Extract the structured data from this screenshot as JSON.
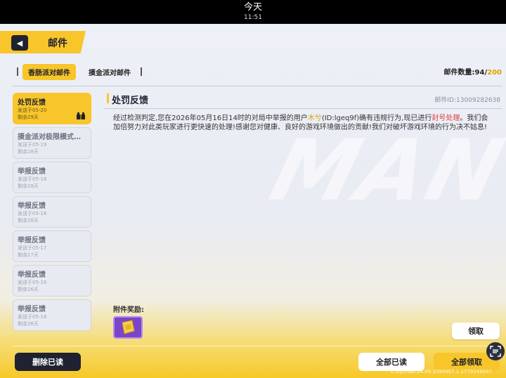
{
  "status_bar": {
    "day": "今天",
    "time": "11:51"
  },
  "header": {
    "title": "邮件"
  },
  "tabs": [
    {
      "label": "香肠派对邮件"
    },
    {
      "label": "摸金派对邮件"
    }
  ],
  "mail_count": {
    "label": "邮件数量:",
    "current": "94",
    "sep": "/",
    "max": "200"
  },
  "mail_list": [
    {
      "title": "处罚反馈",
      "sent": "发送于05-20",
      "remain": "剩余29天"
    },
    {
      "title": "摸金派对极限模式开放…",
      "sent": "发送于05-19",
      "remain": "剩余28天"
    },
    {
      "title": "举报反馈",
      "sent": "发送于05-18",
      "remain": "剩余28天"
    },
    {
      "title": "举报反馈",
      "sent": "发送于05-18",
      "remain": "剩余28天"
    },
    {
      "title": "举报反馈",
      "sent": "发送于05-17",
      "remain": "剩余27天"
    },
    {
      "title": "举报反馈",
      "sent": "发送于05-16",
      "remain": "剩余26天"
    },
    {
      "title": "举报反馈",
      "sent": "发送于05-16",
      "remain": "剩余26天"
    }
  ],
  "detail": {
    "title": "处罚反馈",
    "mail_id": "邮件ID:13009282638",
    "body_part1": "经过检测判定,您在2026年05月16日14时的对局中举报的用户",
    "user_name": "木兮",
    "body_part2": "(ID:lgeq9f)确有违规行为,现已进行",
    "penalty": "封号处理",
    "body_part3": "。我们会加倍努力对此类玩家进行更快速的处理!感谢您对健康、良好的游戏环境做出的贡献!我们对破坏游戏环境的行为决不姑息!",
    "attachment_label": "附件奖励:",
    "collect_label": "领取"
  },
  "footer": {
    "delete_read": "删除已读",
    "read_all": "全部已读",
    "collect_all": "全部领取"
  },
  "watermark": "1.0ly(mab.24.09.3399987.1.1779249047"
}
